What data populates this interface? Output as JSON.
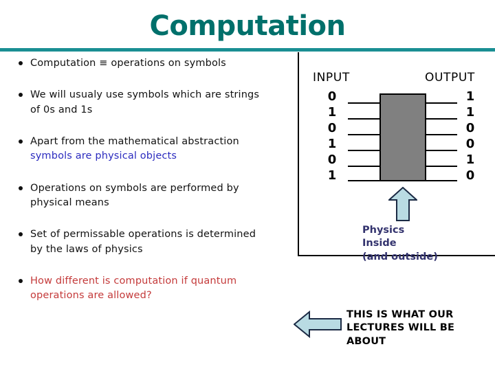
{
  "slide": {
    "title": "Computation",
    "title_color": "#00706b",
    "rule_color": "#1a8f93"
  },
  "bullets": [
    {
      "line_1": "Computation ≡ operations on symbols",
      "line_2": "",
      "color_1": "#111111",
      "color_2": "#111111"
    },
    {
      "line_1": "We will usualy use symbols which are strings",
      "line_2": "of 0s and 1s",
      "color_1": "#111111",
      "color_2": "#111111"
    },
    {
      "line_1": "Apart from the mathematical abstraction",
      "line_2": "symbols are physical objects",
      "color_1": "#111111",
      "color_2": "#2b2bbf"
    },
    {
      "line_1": "Operations on symbols are performed by",
      "line_2": "physical means",
      "color_1": "#111111",
      "color_2": "#111111"
    },
    {
      "line_1": "Set of permissable operations is determined",
      "line_2": "by the laws of physics",
      "color_1": "#111111",
      "color_2": "#111111"
    },
    {
      "line_1": "How different is computation if quantum",
      "line_2": "operations are allowed?",
      "color_1": "#c43a3a",
      "color_2": "#c43a3a"
    }
  ],
  "diagram": {
    "input_label": "INPUT",
    "output_label": "OUTPUT",
    "input_bits": [
      "0",
      "1",
      "0",
      "1",
      "0",
      "1"
    ],
    "output_bits": [
      "1",
      "1",
      "0",
      "0",
      "1",
      "0"
    ],
    "box_color": "#808080",
    "box_border_color": "#000000",
    "wire_count": 6,
    "arrow_fill": "#b9dbe3",
    "arrow_stroke": "#1b2a44"
  },
  "physics_note": {
    "line_1": "Physics",
    "line_2": "Inside",
    "line_3": "(and outside)",
    "color": "#33336e"
  },
  "lectures_note": {
    "line_1": "THIS IS WHAT OUR",
    "line_2": "LECTURES WILL BE",
    "line_3": "ABOUT",
    "color": "#000000"
  }
}
